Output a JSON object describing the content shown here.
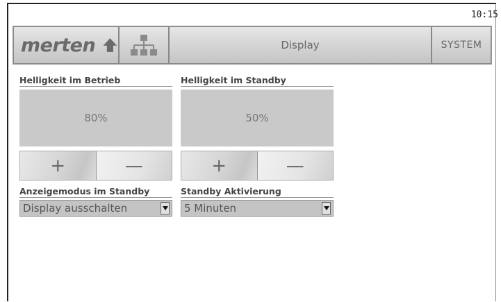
{
  "clock": "10:15",
  "header": {
    "logo_text": "merten",
    "title": "Display",
    "system_label": "SYSTEM",
    "icons": [
      "home-icon",
      "menu-tree-icon"
    ]
  },
  "brightness_operation": {
    "label": "Helligkeit im Betrieb",
    "value": "80%",
    "plus_label": "+",
    "minus_label": "—"
  },
  "brightness_standby": {
    "label": "Helligkeit im Standby",
    "value": "50%",
    "plus_label": "+",
    "minus_label": "—"
  },
  "standby_mode": {
    "label": "Anzeigemodus im Standby",
    "selected": "Display ausschalten"
  },
  "standby_activation": {
    "label": "Standby Aktivierung",
    "selected": "5 Minuten"
  }
}
